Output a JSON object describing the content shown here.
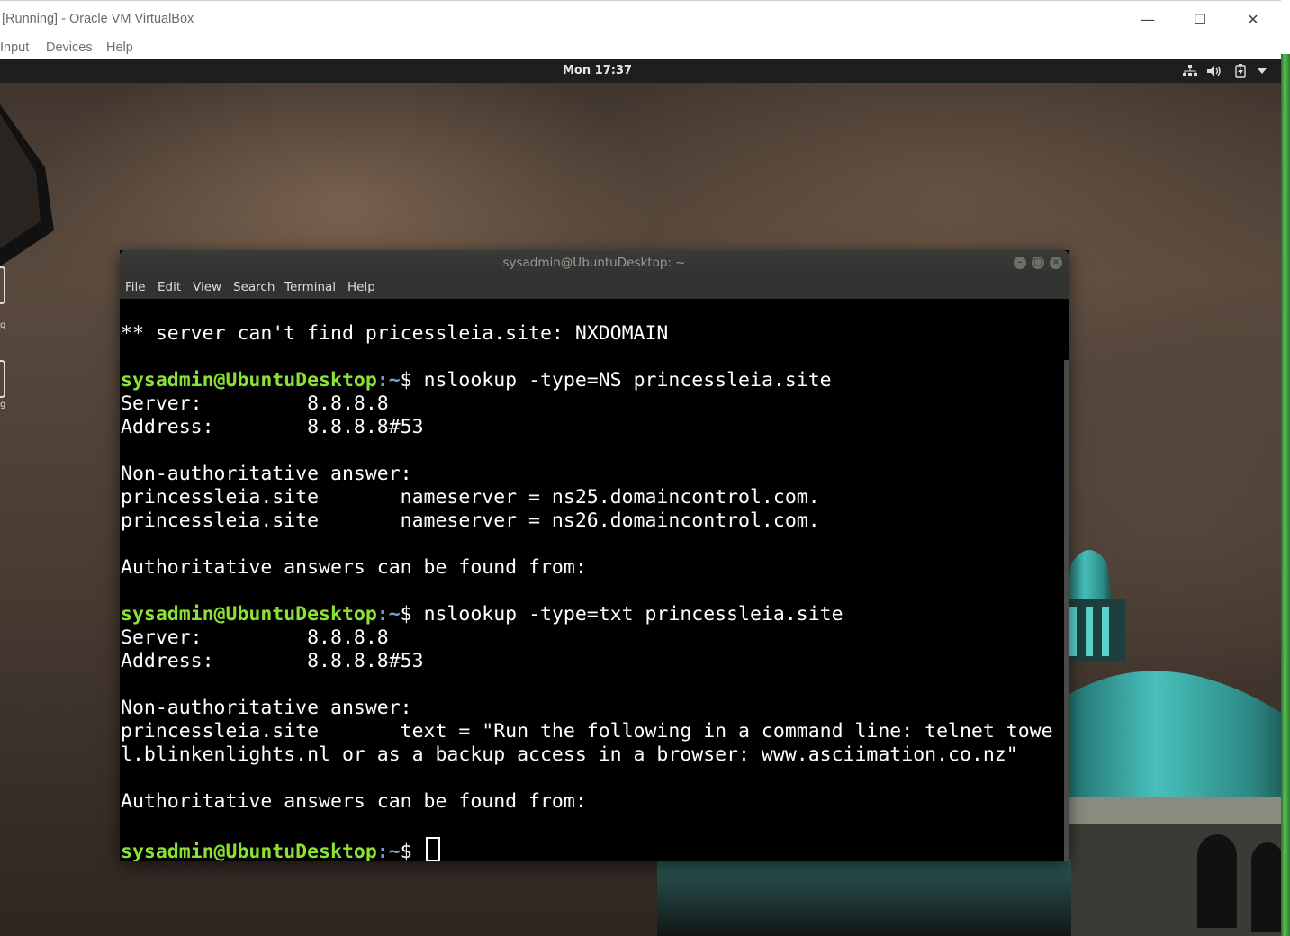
{
  "vbox": {
    "title": "[Running] - Oracle VM VirtualBox",
    "menu": [
      "Input",
      "Devices",
      "Help"
    ],
    "controls": {
      "minimize": "—",
      "maximize": "☐",
      "close": "✕"
    }
  },
  "gnome": {
    "clock": "Mon 17:37",
    "tray_icons": [
      "network-icon",
      "volume-icon",
      "battery-icon",
      "chevron-down-icon"
    ]
  },
  "desktop_icons": [
    {
      "label": "g"
    },
    {
      "label": "g"
    }
  ],
  "terminal": {
    "title": "sysadmin@UbuntuDesktop: ~",
    "menu": [
      "File",
      "Edit",
      "View",
      "Search",
      "Terminal",
      "Help"
    ],
    "prompt_user": "sysadmin@UbuntuDesktop",
    "prompt_path": ":~",
    "prompt_symbol": "$",
    "lines": [
      {
        "type": "text",
        "text": "** server can't find pricessleia.site: NXDOMAIN"
      },
      {
        "type": "text",
        "text": ""
      },
      {
        "type": "prompt",
        "cmd": " nslookup -type=NS princessleia.site"
      },
      {
        "type": "text",
        "text": "Server:         8.8.8.8"
      },
      {
        "type": "text",
        "text": "Address:        8.8.8.8#53"
      },
      {
        "type": "text",
        "text": ""
      },
      {
        "type": "text",
        "text": "Non-authoritative answer:"
      },
      {
        "type": "text",
        "text": "princessleia.site       nameserver = ns25.domaincontrol.com."
      },
      {
        "type": "text",
        "text": "princessleia.site       nameserver = ns26.domaincontrol.com."
      },
      {
        "type": "text",
        "text": ""
      },
      {
        "type": "text",
        "text": "Authoritative answers can be found from:"
      },
      {
        "type": "text",
        "text": ""
      },
      {
        "type": "prompt",
        "cmd": " nslookup -type=txt princessleia.site"
      },
      {
        "type": "text",
        "text": "Server:         8.8.8.8"
      },
      {
        "type": "text",
        "text": "Address:        8.8.8.8#53"
      },
      {
        "type": "text",
        "text": ""
      },
      {
        "type": "text",
        "text": "Non-authoritative answer:"
      },
      {
        "type": "text",
        "text": "princessleia.site       text = \"Run the following in a command line: telnet towe"
      },
      {
        "type": "text",
        "text": "l.blinkenlights.nl or as a backup access in a browser: www.asciimation.co.nz\""
      },
      {
        "type": "text",
        "text": ""
      },
      {
        "type": "text",
        "text": "Authoritative answers can be found from:"
      },
      {
        "type": "text",
        "text": ""
      },
      {
        "type": "prompt",
        "cmd": " ",
        "cursor": true
      }
    ]
  },
  "colors": {
    "prompt_user": "#8ae234",
    "prompt_path": "#729fcf"
  }
}
